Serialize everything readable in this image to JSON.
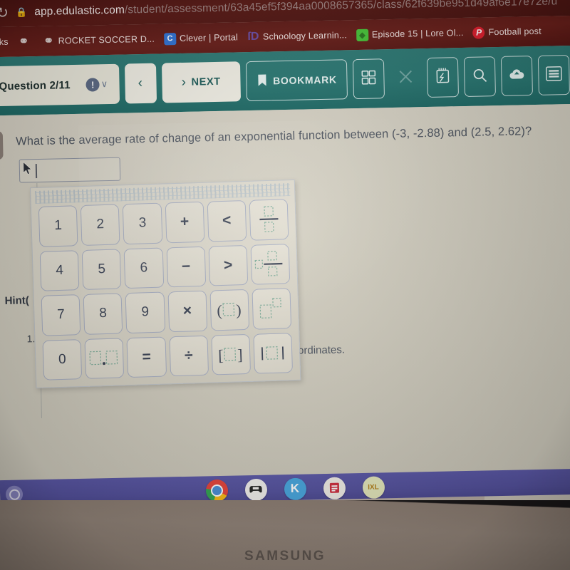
{
  "browser": {
    "reload_icon": "reload-icon",
    "lock_icon": "lock-icon",
    "url_host": "app.edulastic.com",
    "url_path": "/student/assessment/63a45ef5f394aa0008657365/class/62f639be951d49af6e17e72e/u",
    "bookmarks_label": "arks",
    "bookmarks": [
      {
        "label": "",
        "icon": "shield-icon"
      },
      {
        "label": "ROCKET SOCCER D...",
        "icon": "shield-icon"
      },
      {
        "label": "Clever | Portal",
        "icon": "clever-icon"
      },
      {
        "label": "Schoology Learnin...",
        "icon": "schoology-icon"
      },
      {
        "label": "Episode 15 | Lore Ol...",
        "icon": "lore-icon"
      },
      {
        "label": "Football post",
        "icon": "pinterest-icon"
      }
    ]
  },
  "toolbar": {
    "question_counter": "Question 2/11",
    "info_glyph": "!",
    "chevron_glyph": "∨",
    "prev_label": "‹",
    "next_label": "NEXT",
    "next_arrow": "›",
    "bookmark_label": "BOOKMARK",
    "buttons": [
      {
        "name": "calculator-icon"
      },
      {
        "name": "close-icon"
      },
      {
        "name": "notepad-icon"
      },
      {
        "name": "magnifier-icon"
      },
      {
        "name": "cloud-upload-icon"
      },
      {
        "name": "list-menu-icon"
      }
    ],
    "accent_color": "#2a7873",
    "button_bg": "#f2f0e6"
  },
  "question": {
    "side_tab": "⋮",
    "text": "What is the average rate of change of an exponential function between (-3, -2.88) and (2.5, 2.62)?",
    "answer_value": "",
    "answer_placeholder": "",
    "hint_label": "Hint(",
    "list_number": "1.",
    "tail_text": "ordinates."
  },
  "keypad": {
    "keys": [
      {
        "label": "1",
        "name": "key-1",
        "kind": "num"
      },
      {
        "label": "2",
        "name": "key-2",
        "kind": "num"
      },
      {
        "label": "3",
        "name": "key-3",
        "kind": "num"
      },
      {
        "label": "+",
        "name": "key-plus",
        "kind": "op"
      },
      {
        "label": "<",
        "name": "key-less-than",
        "kind": "op"
      },
      {
        "label": "",
        "name": "key-fraction",
        "kind": "fraction"
      },
      {
        "label": "4",
        "name": "key-4",
        "kind": "num"
      },
      {
        "label": "5",
        "name": "key-5",
        "kind": "num"
      },
      {
        "label": "6",
        "name": "key-6",
        "kind": "num"
      },
      {
        "label": "−",
        "name": "key-minus",
        "kind": "op"
      },
      {
        "label": ">",
        "name": "key-greater-than",
        "kind": "op"
      },
      {
        "label": "",
        "name": "key-mixed-number",
        "kind": "mixed"
      },
      {
        "label": "7",
        "name": "key-7",
        "kind": "num"
      },
      {
        "label": "8",
        "name": "key-8",
        "kind": "num"
      },
      {
        "label": "9",
        "name": "key-9",
        "kind": "num"
      },
      {
        "label": "×",
        "name": "key-multiply",
        "kind": "op"
      },
      {
        "label": "",
        "name": "key-parentheses",
        "kind": "paren"
      },
      {
        "label": "",
        "name": "key-exponent",
        "kind": "exponent"
      },
      {
        "label": "0",
        "name": "key-0",
        "kind": "num"
      },
      {
        "label": "",
        "name": "key-decimal-point",
        "kind": "decimal"
      },
      {
        "label": "=",
        "name": "key-equals",
        "kind": "op"
      },
      {
        "label": "÷",
        "name": "key-divide",
        "kind": "op"
      },
      {
        "label": "",
        "name": "key-brackets",
        "kind": "bracket"
      },
      {
        "label": "",
        "name": "key-absolute-value",
        "kind": "abs"
      }
    ]
  },
  "shelf": {
    "launcher_name": "launcher-icon",
    "icons": [
      {
        "name": "chrome-icon",
        "label": ""
      },
      {
        "name": "game-controller-icon",
        "label": "🎮"
      },
      {
        "name": "kahoot-icon",
        "label": "K"
      },
      {
        "name": "slides-icon",
        "label": "▤"
      },
      {
        "name": "ixl-icon",
        "label": "IXL"
      }
    ]
  },
  "device": {
    "brand": "SAMSUNG"
  }
}
